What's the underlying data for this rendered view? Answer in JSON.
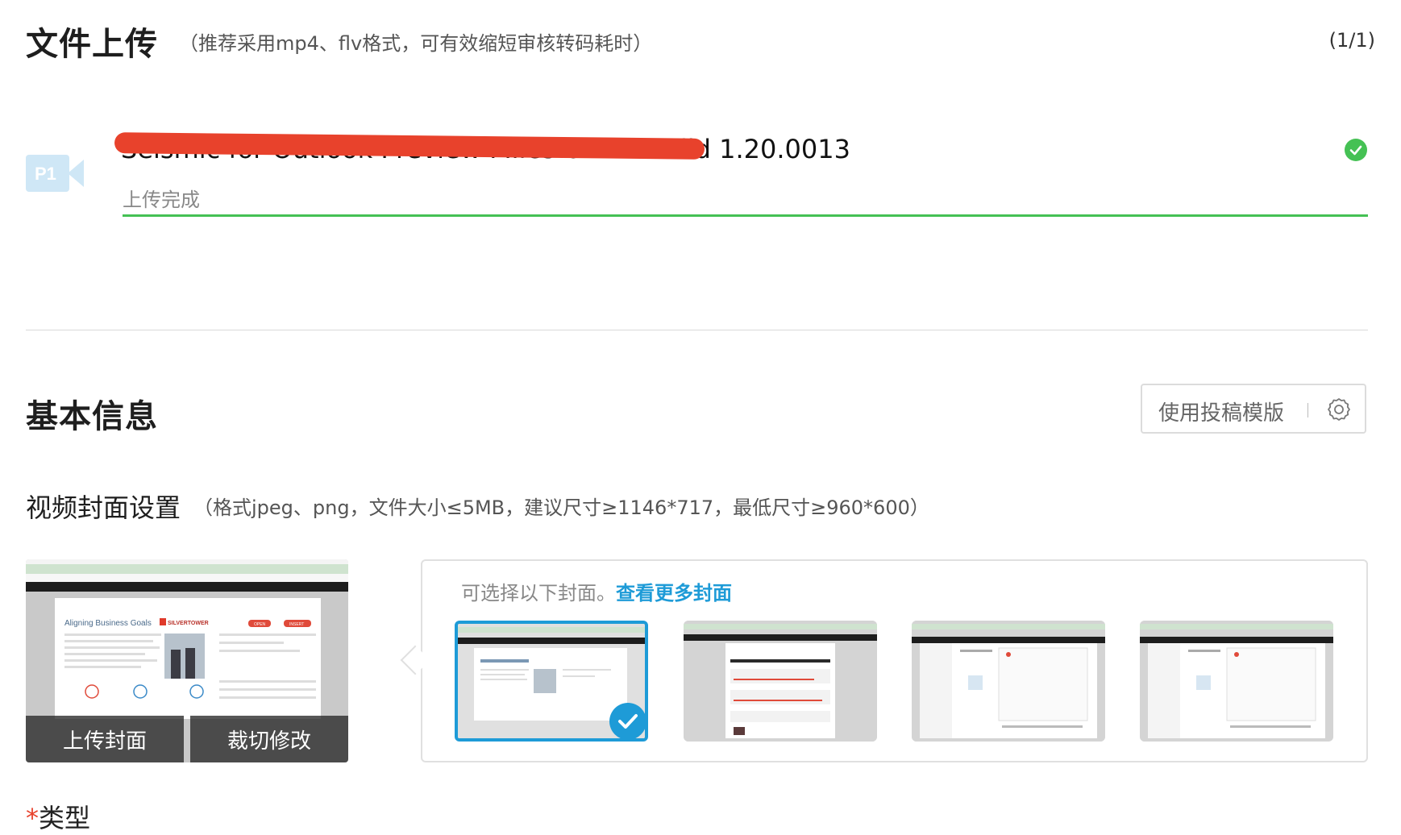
{
  "upload": {
    "title": "文件上传",
    "hint": "（推荐采用mp4、flv格式，可有效缩短审核转码耗时）",
    "count": "(1/1)",
    "part_badge": "P1",
    "file_name": "Seismic for Outlook Preview Milestone 2 Build 1.20.0013",
    "status": "上传完成",
    "progress": 1.0
  },
  "basic": {
    "title": "基本信息",
    "template_button": "使用投稿模版"
  },
  "cover": {
    "title": "视频封面设置",
    "hint": "（格式jpeg、png，文件大小≤5MB，建议尺寸≥1146*717，最低尺寸≥960*600）",
    "upload_button": "上传封面",
    "crop_button": "裁切修改",
    "main_preview": {
      "heading": "Aligning Business Goals",
      "brand": "SILVERTOWER",
      "open_label": "OPEN",
      "insert_label": "INSERT"
    },
    "picker": {
      "prompt": "可选择以下封面。",
      "more_link": "查看更多封面",
      "thumbs": [
        {
          "label": "cover-option-1",
          "selected": true
        },
        {
          "label": "cover-option-2",
          "selected": false
        },
        {
          "label": "cover-option-3",
          "selected": false
        },
        {
          "label": "cover-option-4",
          "selected": false
        }
      ]
    }
  },
  "next_section": {
    "required_mark": "*",
    "label": "类型"
  },
  "colors": {
    "accent_blue": "#1e9bd7",
    "success_green": "#45c154",
    "redaction_red": "#e8422c"
  }
}
